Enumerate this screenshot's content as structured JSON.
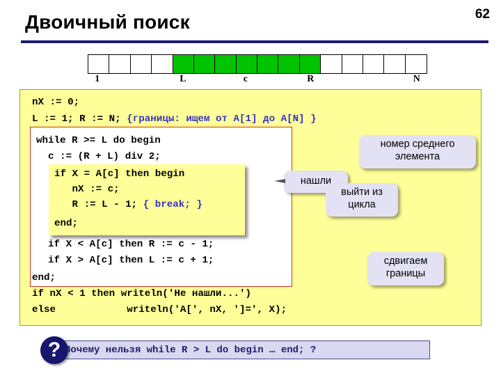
{
  "slide": {
    "title": "Двоичный поиск",
    "page_number": "62",
    "rule_color": "#1b1b6f"
  },
  "array_diagram": {
    "total_cells": 16,
    "green_start_index": 4,
    "green_end_index": 10,
    "green_color": "#00c400",
    "labels": [
      {
        "text": "1",
        "cell_index": 0
      },
      {
        "text": "L",
        "cell_index": 4
      },
      {
        "text": "c",
        "cell_index": 7
      },
      {
        "text": "R",
        "cell_index": 10
      },
      {
        "text": "N",
        "cell_index": 15
      }
    ]
  },
  "code": {
    "panel_bg": "#ffff99",
    "line1": "nX := 0;",
    "line2_a": "L := 1; R := N; ",
    "line2_b": "{границы: ищем от A[1] до A[N] }",
    "while_block": {
      "border_color": "#cc3322",
      "line1": "while R >= L do begin",
      "line2": "  c := (R + L) div 2;",
      "line3": "  if X < A[c] then R := c - 1;",
      "line4": "  if X > A[c] then L := c + 1;",
      "line5": "end;"
    },
    "if_block": {
      "line1": "if X = A[c] then begin",
      "line2": "   nX := c;",
      "line3_a": "   R := L - 1; ",
      "line3_b": "{ break; }",
      "line4": "end;"
    },
    "tail_line1": "if nX < 1 then writeln('Не нашли...')",
    "tail_line2": "else            writeln('A[', nX, ']=', X);"
  },
  "callouts": [
    {
      "id": "mid-element",
      "line1": "номер среднего",
      "line2": "элемента"
    },
    {
      "id": "found",
      "line1": "нашли",
      "line2": ""
    },
    {
      "id": "exit-loop",
      "line1": "выйти из",
      "line2": "цикла"
    },
    {
      "id": "shift-bounds",
      "line1": "сдвигаем",
      "line2": "границы"
    }
  ],
  "question_bar": {
    "icon": "question-mark",
    "text": "Почему нельзя while R > L do begin … end; ?"
  }
}
